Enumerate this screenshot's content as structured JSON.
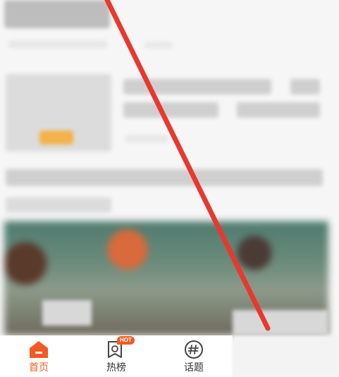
{
  "tabbar": {
    "tabs": [
      {
        "label": "首页",
        "icon": "home-icon",
        "active": true
      },
      {
        "label": "热榜",
        "icon": "hot-list-icon",
        "active": false,
        "badge": "HOT"
      },
      {
        "label": "话题",
        "icon": "topic-hashtag-icon",
        "active": false
      }
    ]
  },
  "colors": {
    "accent": "#f15a24",
    "annotation_line": "#e8382f",
    "tab_text": "#333333"
  }
}
